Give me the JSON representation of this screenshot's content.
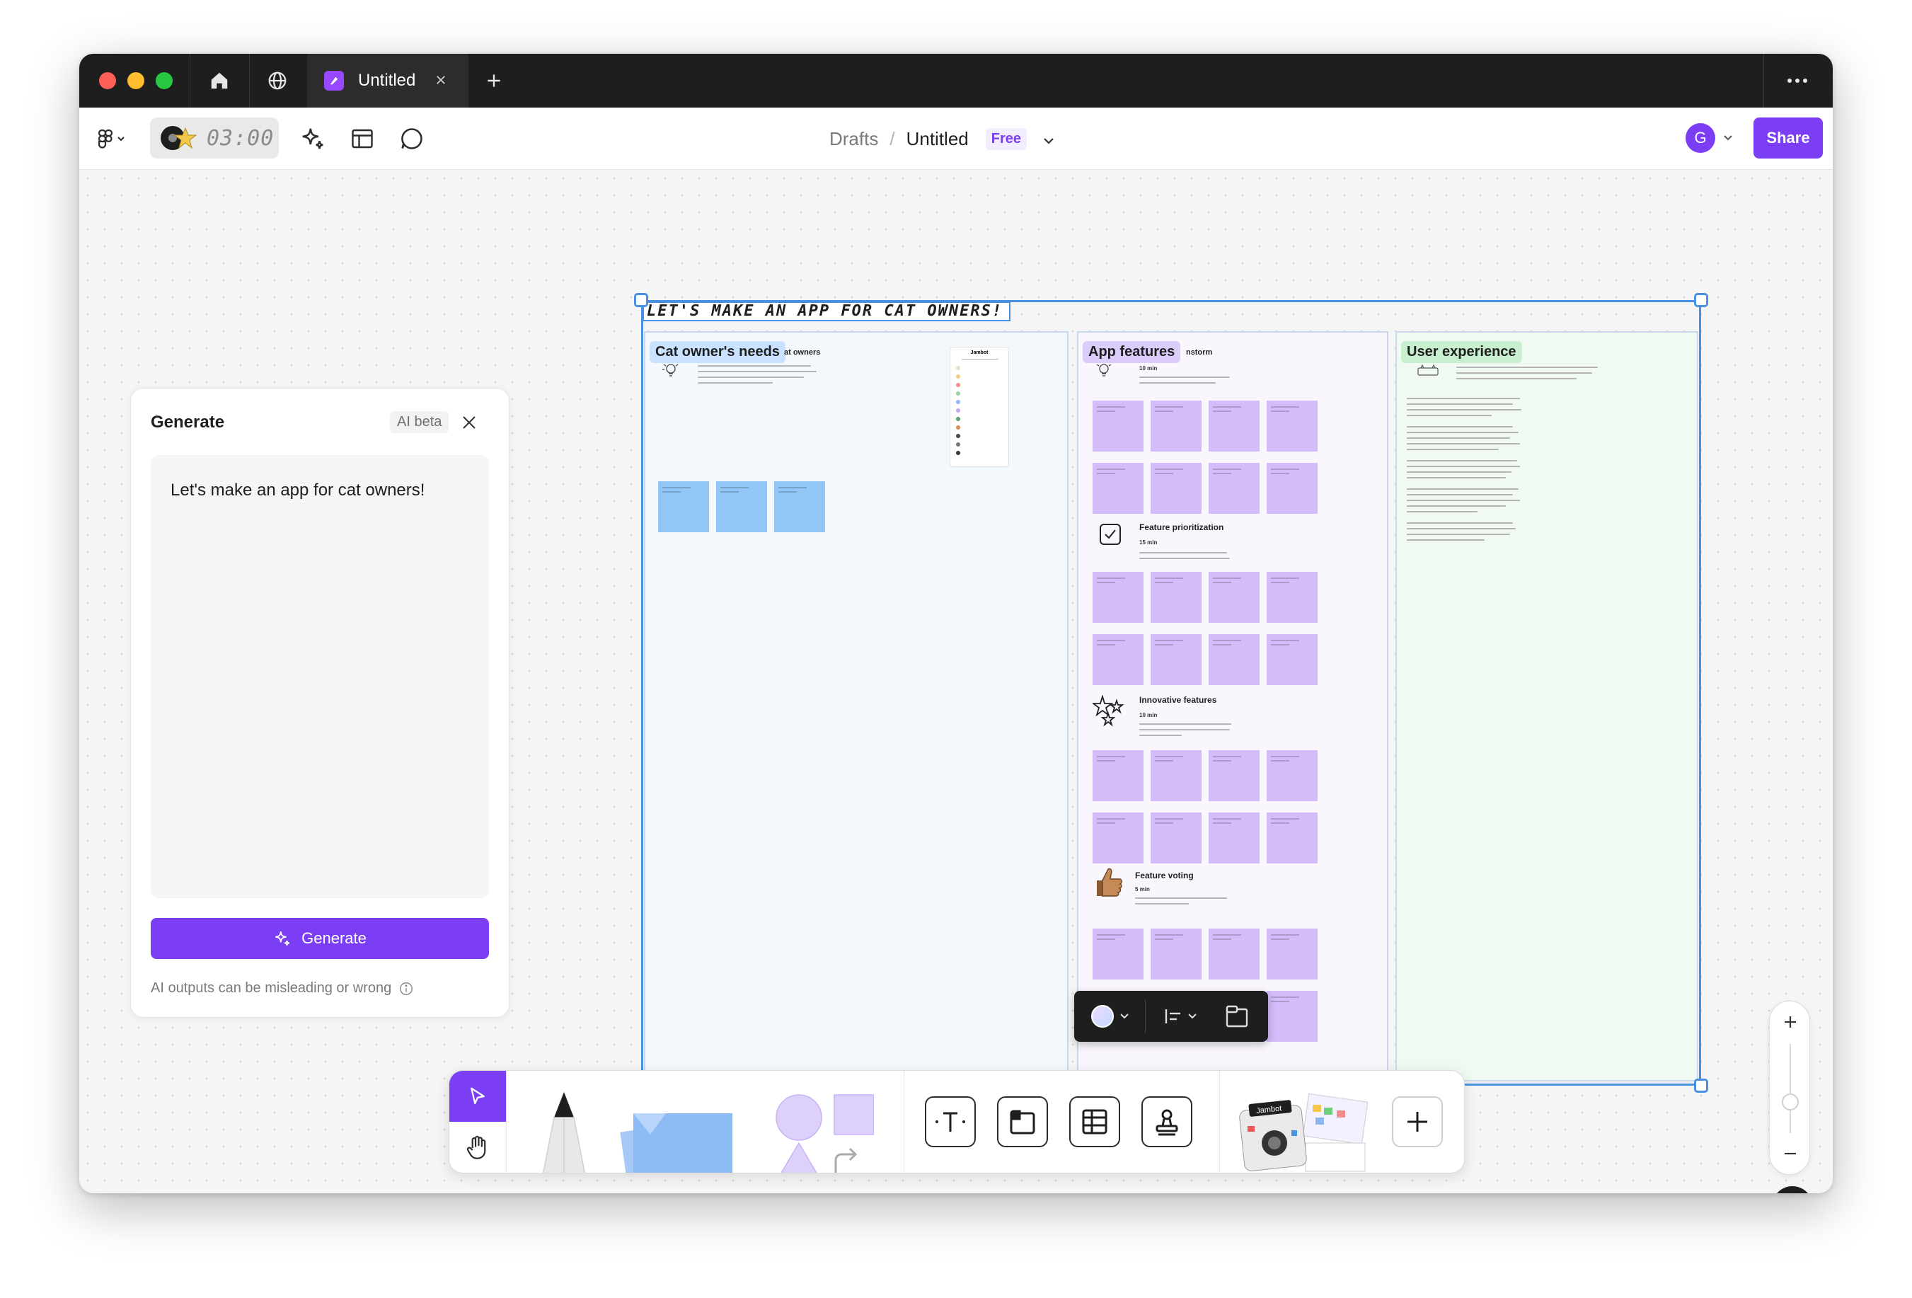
{
  "titlebar": {
    "tab_title": "Untitled",
    "icons": [
      "home-icon",
      "globe-icon",
      "figjam-file-icon",
      "close-icon",
      "plus-icon",
      "more-icon"
    ]
  },
  "toolbar": {
    "timer": "03:00",
    "breadcrumb_parent": "Drafts",
    "breadcrumb_separator": "/",
    "file_name": "Untitled",
    "plan_badge": "Free",
    "avatar_initial": "G",
    "share_label": "Share"
  },
  "generate_panel": {
    "title": "Generate",
    "badge": "AI beta",
    "prompt": "Let's make an app for cat owners!",
    "button_label": "Generate",
    "disclaimer": "AI outputs can be misleading or wrong"
  },
  "board": {
    "title": "LET'S MAKE AN APP FOR CAT OWNERS!",
    "sections": [
      {
        "label": "Cat owner's needs",
        "heading_suffix": "at owners",
        "color": "#f3f8fd",
        "label_bg": "#c9e2ff",
        "sticky_color": "#92c6f7"
      },
      {
        "label": "App features",
        "heading_suffix": "nstorm",
        "color": "#faf6fd",
        "label_bg": "#dcccfc",
        "sticky_color": "#d4bdfa",
        "activities": [
          {
            "title": "Feature prioritization",
            "meta": "15 min"
          },
          {
            "title": "Innovative features",
            "meta": "10 min"
          },
          {
            "title": "Feature voting",
            "meta": "5 min"
          }
        ],
        "first_meta": "10 min"
      },
      {
        "label": "User experience",
        "color": "#f1f9f3",
        "label_bg": "#c8efcf"
      }
    ],
    "jambot_title": "Jambot"
  },
  "dock": {
    "sticker_label": "Jambot"
  },
  "zoom": {
    "level": 0.35
  },
  "help_label": "?",
  "colors": {
    "accent": "#7b3ef5",
    "selection": "#4a90e2",
    "titlebar": "#1e1e1e"
  }
}
